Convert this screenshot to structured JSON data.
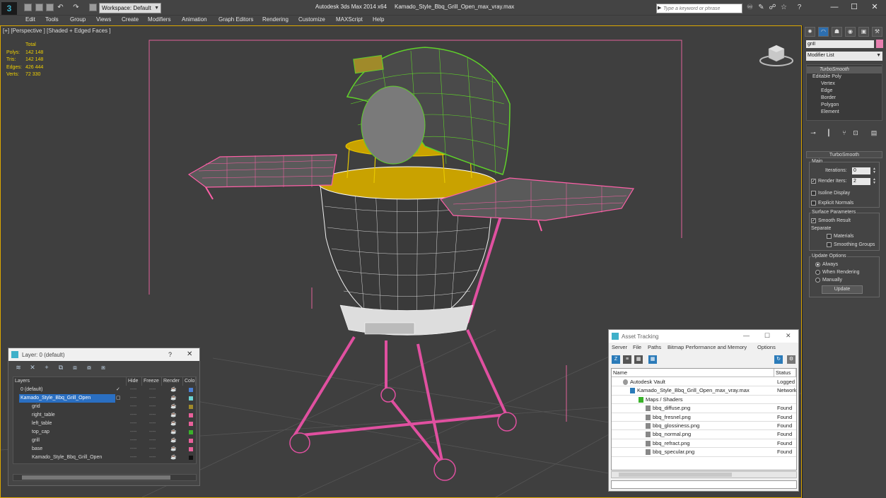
{
  "titlebar": {
    "workspace": "Workspace: Default",
    "app_title": "Autodesk 3ds Max  2014 x64",
    "file_name": "Kamado_Style_Bbq_Grill_Open_max_vray.max",
    "search_placeholder": "Type a keyword or phrase"
  },
  "menu": [
    "Edit",
    "Tools",
    "Group",
    "Views",
    "Create",
    "Modifiers",
    "Animation",
    "Graph Editors",
    "Rendering",
    "Customize",
    "MAXScript",
    "Help"
  ],
  "viewport": {
    "label": "[+] [Perspective ] [Shaded + Edged Faces ]",
    "stats": {
      "header": "Total",
      "rows": [
        {
          "k": "Polys:",
          "v": "142 148"
        },
        {
          "k": "Tris:",
          "v": "142 148"
        },
        {
          "k": "Edges:",
          "v": "426 444"
        },
        {
          "k": "Verts:",
          "v": "72 330"
        }
      ]
    },
    "colors": {
      "selection_border": "#dca700",
      "wire_pink": "#ff4fa0",
      "wire_green": "#5fd12a",
      "wire_yellow": "#d8b400"
    }
  },
  "command_panel": {
    "object_name": "grill",
    "object_color": "#e880b0",
    "modifier_list": "Modifier List",
    "stack": [
      "TurboSmooth",
      "Editable Poly",
      "Vertex",
      "Edge",
      "Border",
      "Polygon",
      "Element"
    ],
    "rollout": {
      "title": "TurboSmooth",
      "main_label": "Main",
      "iterations_label": "Iterations:",
      "iterations_value": "0",
      "render_iters_label": "Render Iters:",
      "render_iters_value": "2",
      "isoline_label": "Isoline Display",
      "explicit_label": "Explicit Normals",
      "surface_label": "Surface Parameters",
      "smooth_result_label": "Smooth Result",
      "separate_label": "Separate",
      "materials_label": "Materials",
      "smoothing_groups_label": "Smoothing Groups",
      "update_options_label": "Update Options",
      "always_label": "Always",
      "when_rendering_label": "When Rendering",
      "manually_label": "Manually",
      "update_button": "Update"
    }
  },
  "layer_window": {
    "title": "Layer: 0 (default)",
    "help": "?",
    "headers": {
      "layers": "Layers",
      "hide": "Hide",
      "freeze": "Freeze",
      "render": "Render",
      "color": "Colo"
    },
    "rows": [
      {
        "name": "0 (default)",
        "indent": 0,
        "color": "#4a7fd4"
      },
      {
        "name": "Kamado_Style_Bbq_Grill_Open",
        "indent": 0,
        "color": "#6ad2d2"
      },
      {
        "name": "grid",
        "indent": 1,
        "color": "#a08a2a"
      },
      {
        "name": "right_table",
        "indent": 1,
        "color": "#e8609a"
      },
      {
        "name": "left_table",
        "indent": 1,
        "color": "#e8609a"
      },
      {
        "name": "top_cap",
        "indent": 1,
        "color": "#3ab22a"
      },
      {
        "name": "grill",
        "indent": 1,
        "color": "#e8609a"
      },
      {
        "name": "base",
        "indent": 1,
        "color": "#e8609a"
      },
      {
        "name": "Kamado_Style_Bbq_Grill_Open",
        "indent": 1,
        "color": "#111111"
      }
    ]
  },
  "asset_window": {
    "title": "Asset Tracking",
    "menu": [
      "Server",
      "File",
      "Paths",
      "Bitmap Performance and Memory",
      "Options"
    ],
    "headers": {
      "name": "Name",
      "status": "Status"
    },
    "rows": [
      {
        "name": "Autodesk Vault",
        "status": "Logged",
        "indent": 0
      },
      {
        "name": "Kamado_Style_Bbq_Grill_Open_max_vray.max",
        "status": "Network",
        "indent": 1
      },
      {
        "name": "Maps / Shaders",
        "status": "",
        "indent": 2
      },
      {
        "name": "bbq_diffuse.png",
        "status": "Found",
        "indent": 3
      },
      {
        "name": "bbq_fresnel.png",
        "status": "Found",
        "indent": 3
      },
      {
        "name": "bbq_glossiness.png",
        "status": "Found",
        "indent": 3
      },
      {
        "name": "bbq_normal.png",
        "status": "Found",
        "indent": 3
      },
      {
        "name": "bbq_refract.png",
        "status": "Found",
        "indent": 3
      },
      {
        "name": "bbq_specular.png",
        "status": "Found",
        "indent": 3
      }
    ]
  }
}
